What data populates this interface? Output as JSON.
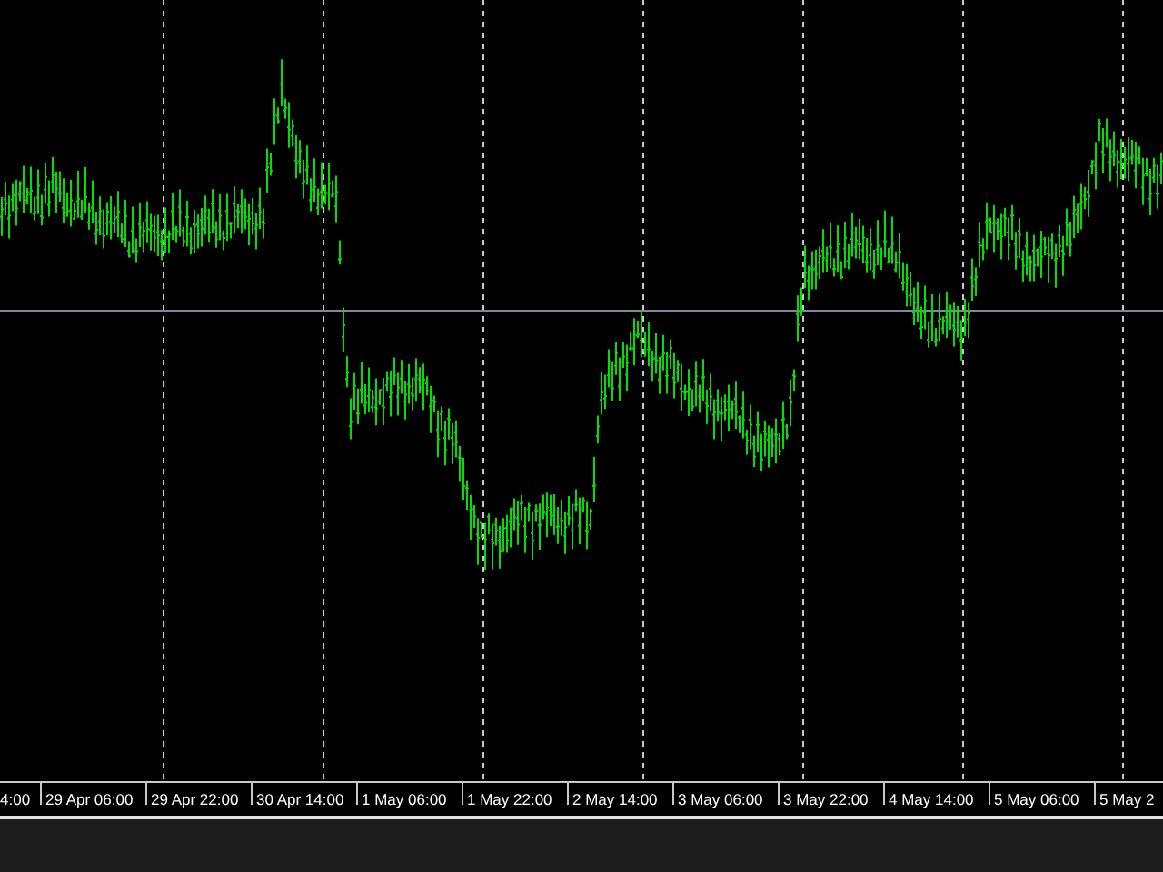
{
  "chart": {
    "x_axis_labels": [
      "4:00",
      "29 Apr 06:00",
      "29 Apr 22:00",
      "30 Apr 14:00",
      "1 May 06:00",
      "1 May 22:00",
      "2 May 14:00",
      "3 May 06:00",
      "3 May 22:00",
      "4 May 14:00",
      "5 May 06:00",
      "5 May 2"
    ]
  }
}
